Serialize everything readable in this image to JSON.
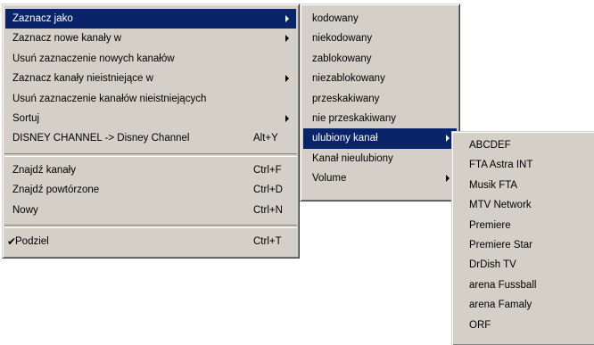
{
  "main_menu": {
    "items": [
      {
        "label": "Zaznacz jako",
        "shortcut": "",
        "submenu": true,
        "selected": true
      },
      {
        "label": "Zaznacz nowe kanały w",
        "shortcut": "",
        "submenu": true,
        "selected": false
      },
      {
        "label": "Usuń zaznaczenie nowych kanałów",
        "shortcut": "",
        "submenu": false,
        "selected": false
      },
      {
        "label": "Zaznacz kanały nieistniejące w",
        "shortcut": "",
        "submenu": true,
        "selected": false
      },
      {
        "label": "Usuń zaznaczenie kanałów nieistniejących",
        "shortcut": "",
        "submenu": false,
        "selected": false
      },
      {
        "label": "Sortuj",
        "shortcut": "",
        "submenu": true,
        "selected": false
      },
      {
        "label": "DISNEY CHANNEL -> Disney Channel",
        "shortcut": "Alt+Y",
        "submenu": false,
        "selected": false
      },
      {
        "label": "Znajdź kanały",
        "shortcut": "Ctrl+F",
        "submenu": false,
        "selected": false
      },
      {
        "label": "Znajdź powtórzone",
        "shortcut": "Ctrl+D",
        "submenu": false,
        "selected": false
      },
      {
        "label": "Nowy",
        "shortcut": "Ctrl+N",
        "submenu": false,
        "selected": false
      },
      {
        "label": "Podziel",
        "shortcut": "Ctrl+T",
        "submenu": false,
        "selected": false,
        "checked": true
      }
    ]
  },
  "mark_as_submenu": {
    "items": [
      {
        "label": "kodowany",
        "submenu": false,
        "selected": false
      },
      {
        "label": "niekodowany",
        "submenu": false,
        "selected": false
      },
      {
        "label": "zablokowany",
        "submenu": false,
        "selected": false
      },
      {
        "label": "niezablokowany",
        "submenu": false,
        "selected": false
      },
      {
        "label": "przeskakiwany",
        "submenu": false,
        "selected": false
      },
      {
        "label": "nie przeskakiwany",
        "submenu": false,
        "selected": false
      },
      {
        "label": "ulubiony kanał",
        "submenu": true,
        "selected": true
      },
      {
        "label": "Kanał nieulubiony",
        "submenu": false,
        "selected": false
      },
      {
        "label": "Volume",
        "submenu": true,
        "selected": false
      }
    ]
  },
  "favorites_submenu": {
    "items": [
      {
        "label": "ABCDEF"
      },
      {
        "label": "FTA Astra INT"
      },
      {
        "label": "Musik FTA"
      },
      {
        "label": "MTV Network"
      },
      {
        "label": "Premiere"
      },
      {
        "label": "Premiere Star"
      },
      {
        "label": "DrDish TV"
      },
      {
        "label": "arena Fussball"
      },
      {
        "label": "arena Famaly"
      },
      {
        "label": "ORF"
      }
    ]
  },
  "colors": {
    "menu_background": "#d4d0c8",
    "selection_background": "#0a246a",
    "selection_text": "#ffffff"
  },
  "icons": {
    "submenu_arrow": "submenu-arrow-icon",
    "check": "check-icon",
    "check_glyph": "✔"
  }
}
